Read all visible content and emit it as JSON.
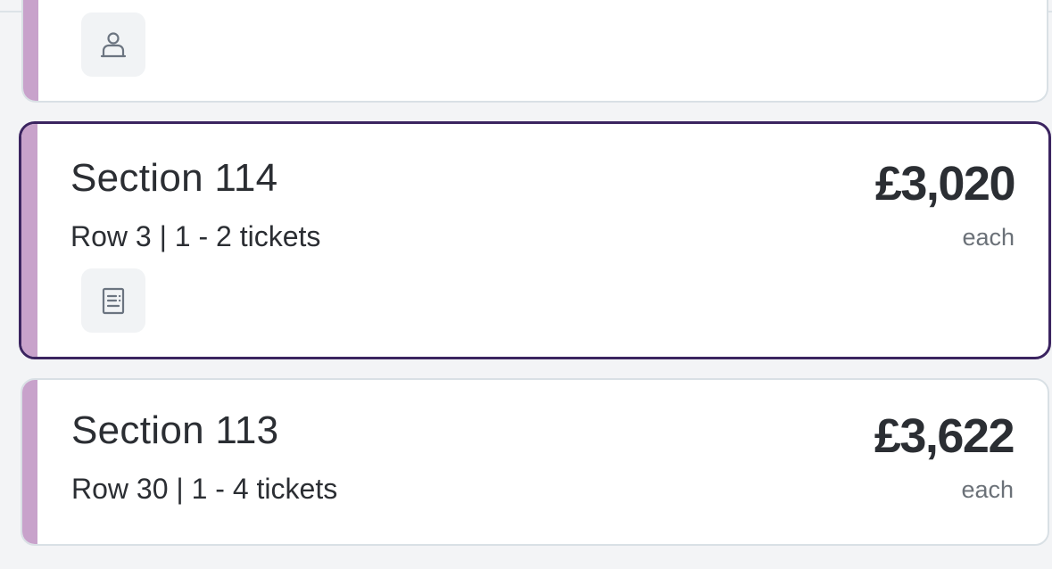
{
  "listings": [
    {
      "feature_icon": "person-icon"
    },
    {
      "section": "Section 114",
      "row_info": "Row 3 | 1 - 2 tickets",
      "price": "£3,020",
      "price_unit": "each",
      "feature_icon": "document-icon",
      "selected": true
    },
    {
      "section": "Section 113",
      "row_info": "Row 30 | 1 - 4 tickets",
      "price": "£3,622",
      "price_unit": "each"
    }
  ],
  "colors": {
    "accent_stripe": "#c8a2cb",
    "selected_border": "#3b2460",
    "text_primary": "#2b2e33",
    "text_secondary": "#6b7178",
    "background": "#f3f4f6"
  }
}
